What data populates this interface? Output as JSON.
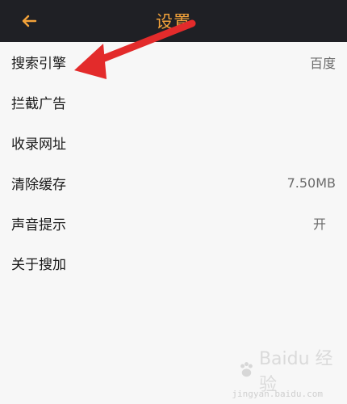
{
  "header": {
    "title": "设置",
    "back_icon": "arrow-left-icon",
    "accent_color": "#F2A23A",
    "background_color": "#1F2025"
  },
  "settings": [
    {
      "label": "搜索引擎",
      "value": "百度"
    },
    {
      "label": "拦截广告",
      "value": ""
    },
    {
      "label": "收录网址",
      "value": ""
    },
    {
      "label": "清除缓存",
      "value": "7.50MB"
    },
    {
      "label": "声音提示",
      "value": "开"
    },
    {
      "label": "关于搜加",
      "value": ""
    }
  ],
  "annotation": {
    "type": "red-arrow",
    "color": "#E32B2B"
  },
  "watermark": {
    "brand": "Baidu 经验",
    "url": "jingyan.baidu.com"
  }
}
